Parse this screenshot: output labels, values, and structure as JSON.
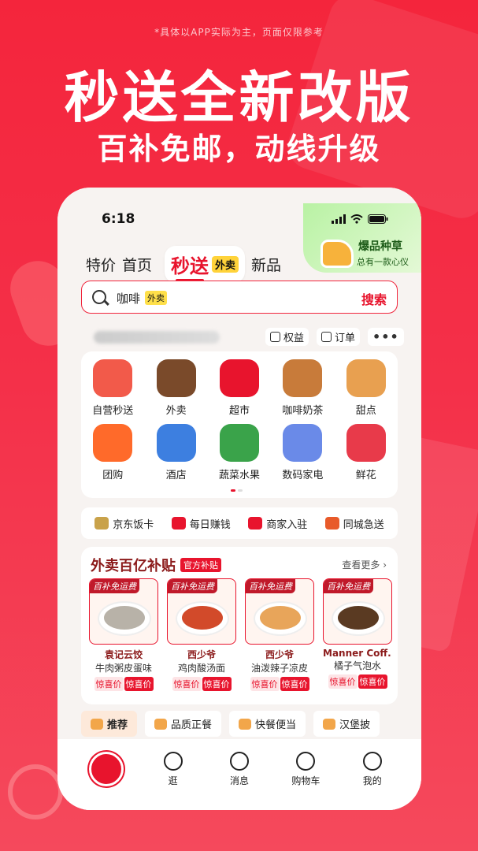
{
  "note": "*具体以APP实际为主，页面仅限参考",
  "headline": "秒送全新改版",
  "subline": "百补免邮，动线升级",
  "phone": {
    "time": "6:18",
    "promo": {
      "title": "爆品种草",
      "sub": "总有一款心仪"
    },
    "tabs": [
      "特价",
      "首页"
    ],
    "active_tab": {
      "label": "秒送",
      "badge": "外卖"
    },
    "tab_after": "新品",
    "search": {
      "text": "咖啡",
      "tag": "外卖",
      "button": "搜索"
    },
    "tools": [
      {
        "label": "权益",
        "icon": "crown-icon"
      },
      {
        "label": "订单",
        "icon": "receipt-icon"
      }
    ],
    "categories": [
      {
        "label": "自营秒送",
        "icon": "basket-icon",
        "color": "#f25a4a"
      },
      {
        "label": "外卖",
        "icon": "takeout-bag-icon",
        "color": "#7a4a2a"
      },
      {
        "label": "超市",
        "icon": "store-24h-icon",
        "color": "#e8142d"
      },
      {
        "label": "咖啡奶茶",
        "icon": "coffee-cup-icon",
        "color": "#c87b3a"
      },
      {
        "label": "甜点",
        "icon": "cake-icon",
        "color": "#e8a050"
      },
      {
        "label": "团购",
        "icon": "coupon-icon",
        "color": "#ff6a2a"
      },
      {
        "label": "酒店",
        "icon": "building-icon",
        "color": "#3d7fe0"
      },
      {
        "label": "蔬菜水果",
        "icon": "vegetable-icon",
        "color": "#3aa34a"
      },
      {
        "label": "数码家电",
        "icon": "phone-icon",
        "color": "#6a8ae8"
      },
      {
        "label": "鲜花",
        "icon": "rose-icon",
        "color": "#e83a4a"
      }
    ],
    "services": [
      {
        "label": "京东饭卡",
        "icon": "meal-card-icon",
        "color": "#c9a24a"
      },
      {
        "label": "每日赚钱",
        "icon": "calendar-icon",
        "color": "#e8142d"
      },
      {
        "label": "商家入驻",
        "icon": "shop-icon",
        "color": "#e8142d"
      },
      {
        "label": "同城急送",
        "icon": "runner-icon",
        "color": "#e85a2a"
      }
    ],
    "deal": {
      "title": "外卖百亿补贴",
      "badge": "官方补贴",
      "more": "查看更多 ›",
      "items": [
        {
          "tag": "百补免运费",
          "shop": "袁记云饺",
          "dish": "牛肉粥皮蛋味",
          "food_color": "#b8b2a8",
          "p1": "惊喜价",
          "p2": "惊喜价"
        },
        {
          "tag": "百补免运费",
          "shop": "西少爷",
          "dish": "鸡肉酸汤面",
          "food_color": "#d24a2a",
          "p1": "惊喜价",
          "p2": "惊喜价"
        },
        {
          "tag": "百补免运费",
          "shop": "西少爷",
          "dish": "油泼辣子凉皮",
          "food_color": "#e8a55a",
          "p1": "惊喜价",
          "p2": "惊喜价"
        },
        {
          "tag": "百补免运费",
          "shop": "Manner Coff...",
          "dish": "橘子气泡水",
          "food_color": "#5a3a22",
          "p1": "惊喜价",
          "p2": "惊喜价"
        }
      ]
    },
    "filters": [
      "推荐",
      "品质正餐",
      "快餐便当",
      "汉堡披"
    ],
    "nav": [
      {
        "label": "",
        "icon": "jd-home-icon"
      },
      {
        "label": "逛",
        "icon": "stroll-icon"
      },
      {
        "label": "消息",
        "icon": "message-icon"
      },
      {
        "label": "购物车",
        "icon": "cart-icon"
      },
      {
        "label": "我的",
        "icon": "user-icon"
      }
    ]
  }
}
